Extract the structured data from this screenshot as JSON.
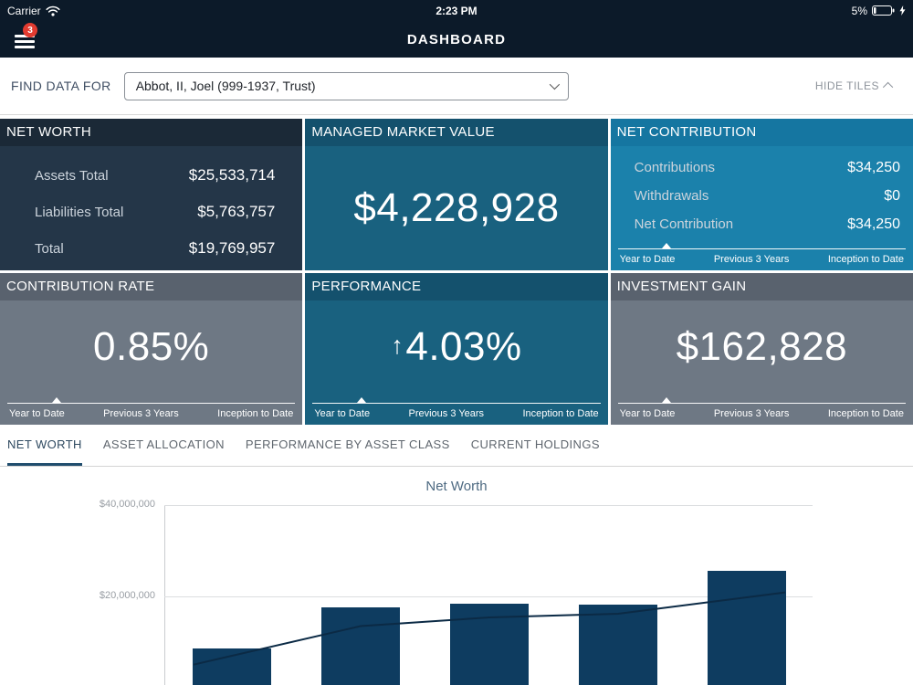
{
  "status_bar": {
    "carrier": "Carrier",
    "time": "2:23 PM",
    "battery_pct": "5%"
  },
  "nav": {
    "title": "DASHBOARD",
    "menu_badge": "3"
  },
  "find_bar": {
    "label": "FIND DATA FOR",
    "selected_value": "Abbot, II, Joel (999-1937, Trust)",
    "hide_tiles_label": "HIDE TILES"
  },
  "period_labels": [
    "Year to Date",
    "Previous 3 Years",
    "Inception to Date"
  ],
  "tiles": {
    "net_worth": {
      "title": "NET WORTH",
      "rows": [
        {
          "label": "Assets Total",
          "value": "$25,533,714"
        },
        {
          "label": "Liabilities Total",
          "value": "$5,763,757"
        },
        {
          "label": "Total",
          "value": "$19,769,957"
        }
      ]
    },
    "managed_market_value": {
      "title": "MANAGED MARKET VALUE",
      "value": "$4,228,928"
    },
    "net_contribution": {
      "title": "NET CONTRIBUTION",
      "rows": [
        {
          "label": "Contributions",
          "value": "$34,250"
        },
        {
          "label": "Withdrawals",
          "value": "$0"
        },
        {
          "label": "Net Contribution",
          "value": "$34,250"
        }
      ],
      "active_period": "Year to Date"
    },
    "contribution_rate": {
      "title": "CONTRIBUTION RATE",
      "value": "0.85%",
      "active_period": "Year to Date"
    },
    "performance": {
      "title": "PERFORMANCE",
      "arrow": "↑",
      "value": "4.03%",
      "direction": "up",
      "active_period": "Year to Date"
    },
    "investment_gain": {
      "title": "INVESTMENT GAIN",
      "value": "$162,828",
      "active_period": "Year to Date"
    }
  },
  "tabs": [
    {
      "label": "NET WORTH",
      "active": true
    },
    {
      "label": "ASSET ALLOCATION",
      "active": false
    },
    {
      "label": "PERFORMANCE BY ASSET CLASS",
      "active": false
    },
    {
      "label": "CURRENT HOLDINGS",
      "active": false
    }
  ],
  "chart_data": {
    "type": "bar",
    "title": "Net Worth",
    "series": [
      {
        "name": "Net Worth bars",
        "type": "bar",
        "values": [
          8600000,
          17600000,
          18400000,
          18200000,
          25600000
        ]
      },
      {
        "name": "Trend line",
        "type": "line",
        "values": [
          7000000,
          13500000,
          15400000,
          16200000,
          19800000
        ]
      }
    ],
    "ylim": [
      0,
      40000000
    ],
    "y_ticks": [
      {
        "value": 40000000,
        "label": "$40,000,000"
      },
      {
        "value": 20000000,
        "label": "$20,000,000"
      }
    ],
    "grid": true,
    "legend": false,
    "x_axis_labels_cut_off": true,
    "colors": {
      "bar": "#0e3c60",
      "line": "#0b2a45"
    }
  },
  "colors": {
    "header_bg": "#0c1a29",
    "tile_dark_header": "#1b2937",
    "tile_dark_body": "#243648",
    "tile_blue_header": "#14516d",
    "tile_blue_body": "#19617f",
    "tile_lightblue_header": "#1576a1",
    "tile_lightblue_body": "#1b81ab",
    "tile_gray_header": "#59626e",
    "tile_gray_body": "#6e7884",
    "badge_red": "#e23b30",
    "tab_active_underline": "#204d6d"
  }
}
